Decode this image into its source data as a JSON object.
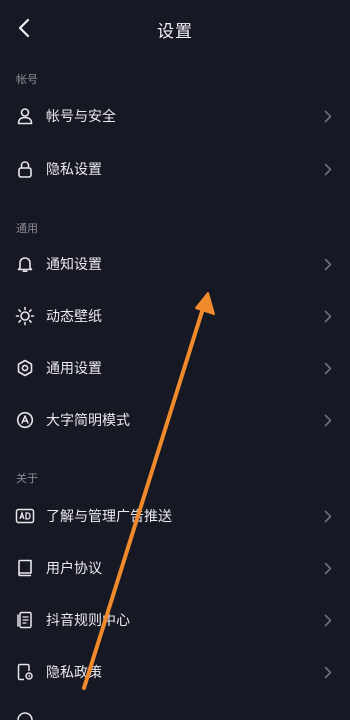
{
  "header": {
    "title": "设置",
    "back_icon": "chevron-left-icon"
  },
  "sections": {
    "account": {
      "label": "帐号"
    },
    "general": {
      "label": "通用"
    },
    "about": {
      "label": "关于"
    }
  },
  "items": {
    "account_security": {
      "label": "帐号与安全",
      "icon": "user-icon"
    },
    "privacy_settings": {
      "label": "隐私设置",
      "icon": "lock-icon"
    },
    "notification_settings": {
      "label": "通知设置",
      "icon": "bell-icon"
    },
    "live_wallpaper": {
      "label": "动态壁纸",
      "icon": "sun-icon"
    },
    "general_settings": {
      "label": "通用设置",
      "icon": "gear-icon"
    },
    "large_font_mode": {
      "label": "大字简明模式",
      "icon": "font-mode-icon"
    },
    "ad_management": {
      "label": "了解与管理广告推送",
      "icon": "ad-icon"
    },
    "user_agreement": {
      "label": "用户协议",
      "icon": "book-icon"
    },
    "community_rules": {
      "label": "抖音规则中心",
      "icon": "document-icon"
    },
    "privacy_policy": {
      "label": "隐私政策",
      "icon": "policy-icon"
    }
  },
  "colors": {
    "background": "#161823",
    "text": "#e9eaee",
    "section_label": "#8a8b93",
    "chevron": "#6e6f78",
    "annotation_arrow": "#f08a2c"
  }
}
